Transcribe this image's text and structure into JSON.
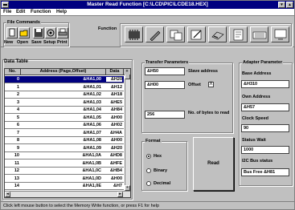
{
  "window": {
    "title": "Master Read Function [C:\\LCD\\PIC\\LCDE18.HEX]"
  },
  "menu": [
    "File",
    "Edit",
    "Function",
    "Help"
  ],
  "file_commands": {
    "label": "File Commands",
    "buttons": [
      "New",
      "Open",
      "Save",
      "Setup",
      "Print"
    ]
  },
  "function_group": {
    "label": "Function"
  },
  "data_table": {
    "label": "Data Table",
    "headers": [
      "No.",
      "Address (Page,Offset)",
      "Data"
    ],
    "rows": [
      {
        "no": "0",
        "address": "&HA1,00",
        "data": "&H20"
      },
      {
        "no": "1",
        "address": "&HA1,01",
        "data": "&H12"
      },
      {
        "no": "2",
        "address": "&HA1,02",
        "data": "&H18"
      },
      {
        "no": "3",
        "address": "&HA1,03",
        "data": "&HE5"
      },
      {
        "no": "4",
        "address": "&HA1,04",
        "data": "&H84"
      },
      {
        "no": "5",
        "address": "&HA1,05",
        "data": "&H00"
      },
      {
        "no": "6",
        "address": "&HA1,06",
        "data": "&H02"
      },
      {
        "no": "7",
        "address": "&HA1,07",
        "data": "&H4A"
      },
      {
        "no": "8",
        "address": "&HA1,08",
        "data": "&H00"
      },
      {
        "no": "9",
        "address": "&HA1,09",
        "data": "&H20"
      },
      {
        "no": "10",
        "address": "&HA1,0A",
        "data": "&HD8"
      },
      {
        "no": "11",
        "address": "&HA1,0B",
        "data": "&HFE"
      },
      {
        "no": "12",
        "address": "&HA1,0C",
        "data": "&HB4"
      },
      {
        "no": "13",
        "address": "&HA1,0D",
        "data": "&H00"
      },
      {
        "no": "14",
        "address": "&HA1,0E",
        "data": "&H7"
      }
    ]
  },
  "transfer": {
    "label": "Transfer Parameters",
    "slave_address": "&H50",
    "slave_address_label": "Slave address",
    "offset": "&H00",
    "offset_label": "Offset",
    "offset_checked": "X",
    "bytes": "256",
    "bytes_label": "No. of bytes to read"
  },
  "format": {
    "label": "Format",
    "options": [
      "Hex",
      "Binary",
      "Decimal"
    ],
    "selected": "Hex"
  },
  "read_button": "Read",
  "adapter": {
    "label": "Adapter Parameter",
    "base_address_label": "Base Address",
    "base_address": "&H310",
    "own_address_label": "Own Address",
    "own_address": "&H57",
    "clock_speed_label": "Clock Speed",
    "clock_speed": "90",
    "status_wait_label": "Status Wait",
    "status_wait": "1000",
    "bus_status_label": "I2C Bus status",
    "bus_status": "Bus Free &H81"
  },
  "status_bar": "Click left mouse button to select the Memory Write function, or press F1 for help"
}
